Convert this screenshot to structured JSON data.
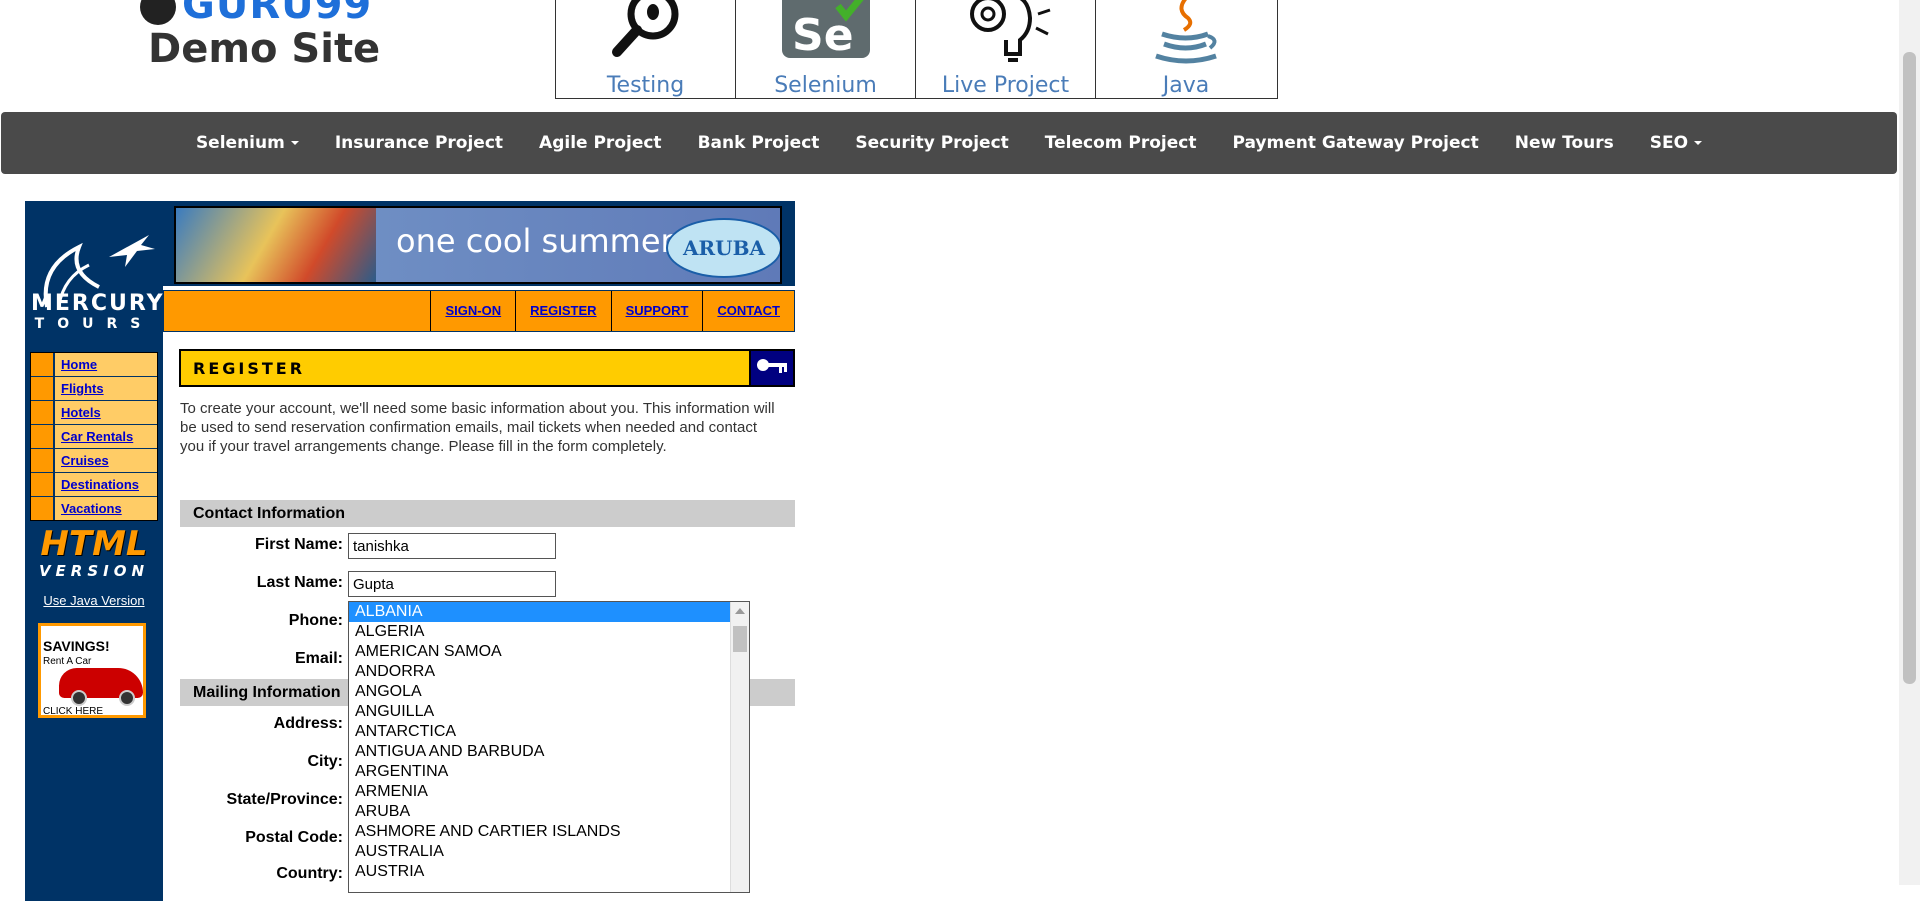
{
  "header": {
    "brand": "GURU99",
    "subtitle": "Demo Site",
    "tiles": [
      {
        "label": "Testing",
        "icon": "magnifier-bug-icon"
      },
      {
        "label": "Selenium",
        "icon": "selenium-se-icon"
      },
      {
        "label": "Live Project",
        "icon": "bulb-gears-icon"
      },
      {
        "label": "Java",
        "icon": "java-cup-icon"
      }
    ]
  },
  "navbar": {
    "items": [
      {
        "label": "Selenium",
        "dropdown": true
      },
      {
        "label": "Insurance Project"
      },
      {
        "label": "Agile Project"
      },
      {
        "label": "Bank Project"
      },
      {
        "label": "Security Project"
      },
      {
        "label": "Telecom Project"
      },
      {
        "label": "Payment Gateway Project"
      },
      {
        "label": "New Tours"
      },
      {
        "label": "SEO",
        "dropdown": true
      }
    ]
  },
  "mercury": {
    "logo_line1": "MERCURY",
    "logo_line2": "TOURS",
    "side_nav": [
      "Home",
      "Flights",
      "Hotels",
      "Car Rentals",
      "Cruises",
      "Destinations",
      "Vacations"
    ],
    "html_version_line1": "HTML",
    "html_version_line2": "VERSION",
    "java_link": "Use Java Version",
    "ad": {
      "title": "SAVINGS!",
      "subtitle": "Rent A Car",
      "cta": "CLICK HERE"
    },
    "banner_text": "one cool summer",
    "banner_badge": "ARUBA",
    "top_links": [
      "SIGN-ON",
      "REGISTER",
      "SUPPORT",
      "CONTACT"
    ]
  },
  "form": {
    "title": "REGISTER",
    "intro": "To create your account, we'll need some basic information about you. This information will be used to send reservation confirmation emails, mail tickets when needed and contact you if your travel arrangements change. Please fill in the form completely.",
    "contact_section": "Contact Information",
    "mailing_section": "Mailing Information",
    "labels": {
      "first_name": "First Name:",
      "last_name": "Last Name:",
      "phone": "Phone:",
      "email": "Email:",
      "address": "Address:",
      "city": "City:",
      "state": "State/Province:",
      "postal": "Postal Code:",
      "country": "Country:"
    },
    "values": {
      "first_name": "tanishka",
      "last_name": "Gupta"
    },
    "country_options": [
      "ALBANIA",
      "ALGERIA",
      "AMERICAN SAMOA",
      "ANDORRA",
      "ANGOLA",
      "ANGUILLA",
      "ANTARCTICA",
      "ANTIGUA AND BARBUDA",
      "ARGENTINA",
      "ARMENIA",
      "ARUBA",
      "ASHMORE AND CARTIER ISLANDS",
      "AUSTRALIA",
      "AUSTRIA"
    ],
    "country_selected": "ALBANIA"
  },
  "colors": {
    "navbar": "#4a4a4a",
    "mercury_navy": "#003366",
    "orange": "#FF9900",
    "yellow": "#FFCC00",
    "selection": "#1e90ff"
  }
}
